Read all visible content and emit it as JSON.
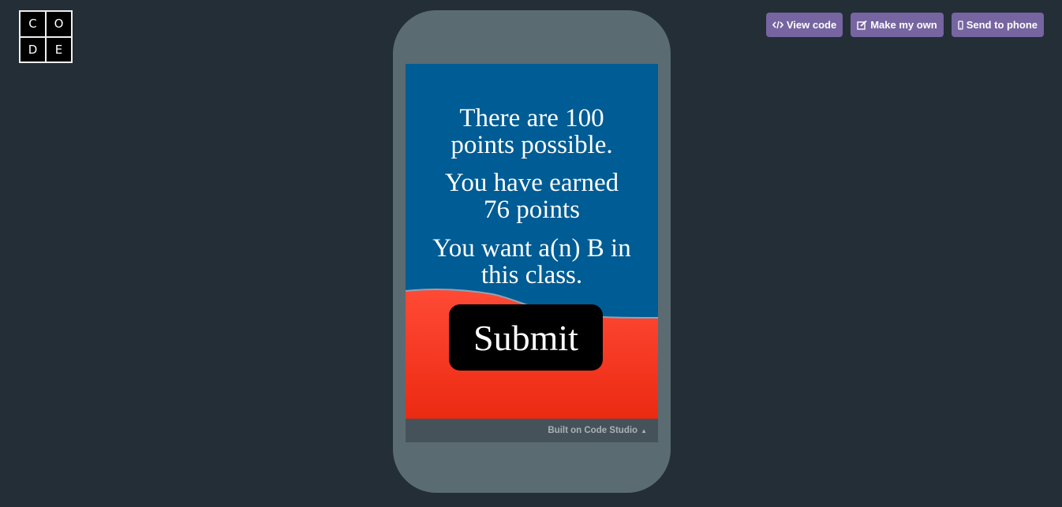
{
  "logo": {
    "letters": [
      "C",
      "O",
      "D",
      "E"
    ]
  },
  "actions": {
    "view_code": "View code",
    "make_my_own": "Make my own",
    "send_to_phone": "Send to phone",
    "accent_color": "#7665a0"
  },
  "app": {
    "line1a": "There are 100",
    "line1b": "points possible.",
    "line2a": "You have earned",
    "line2b": "76 points",
    "line3a": "You want a(n) B in",
    "line3b": "this class.",
    "submit_label": "Submit",
    "sky_color": "#005c94",
    "ground_color": "#f4391f"
  },
  "footer": {
    "built_on": "Built on Code Studio",
    "caret": "▲"
  }
}
